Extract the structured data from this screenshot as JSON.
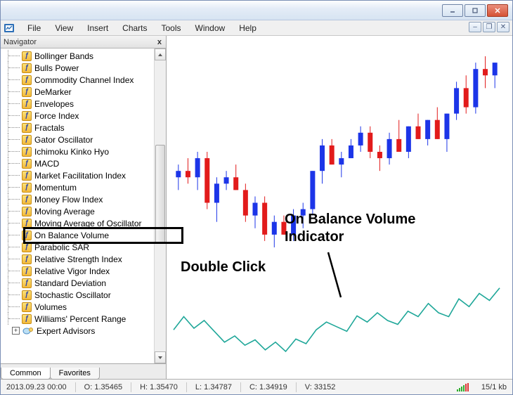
{
  "machine": {
    "window_buttons": {
      "minimize": "–",
      "maximize": "□",
      "close": "✕"
    }
  },
  "menu": {
    "items": [
      "File",
      "View",
      "Insert",
      "Charts",
      "Tools",
      "Window",
      "Help"
    ]
  },
  "inner_window_buttons": {
    "minimize": "–",
    "restore": "❐",
    "close": "✕"
  },
  "navigator": {
    "title": "Navigator",
    "close_glyph": "x",
    "indicators": [
      "Bollinger Bands",
      "Bulls Power",
      "Commodity Channel Index",
      "DeMarker",
      "Envelopes",
      "Force Index",
      "Fractals",
      "Gator Oscillator",
      "Ichimoku Kinko Hyo",
      "MACD",
      "Market Facilitation Index",
      "Momentum",
      "Money Flow Index",
      "Moving Average",
      "Moving Average of Oscillator",
      "On Balance Volume",
      "Parabolic SAR",
      "Relative Strength Index",
      "Relative Vigor Index",
      "Standard Deviation",
      "Stochastic Oscillator",
      "Volumes",
      "Williams' Percent Range"
    ],
    "expert_advisors_label": "Expert Advisors",
    "highlighted_index": 15,
    "tabs": {
      "common": "Common",
      "favorites": "Favorites"
    }
  },
  "annotations": {
    "double_click": "Double Click",
    "obv_title_line1": "On Balance Volume",
    "obv_title_line2": "Indicator"
  },
  "status": {
    "datetime": "2013.09.23 00:00",
    "open_label": "O:",
    "open": "1.35465",
    "high_label": "H:",
    "high": "1.35470",
    "low_label": "L:",
    "low": "1.34787",
    "close_label": "C:",
    "close": "1.34919",
    "vol_label": "V:",
    "vol": "33152",
    "connection": "15/1 kb"
  },
  "colors": {
    "bull": "#1c35e8",
    "bear": "#e21b1b",
    "obv_line": "#1fa799",
    "axis_text": "#000"
  },
  "chart_data": {
    "type": "candlestick",
    "note": "approximate values read from pixels; price axis not visibly labeled",
    "y_range": [
      1.34,
      1.372
    ],
    "obv_y_range": [
      0,
      100
    ],
    "candles": [
      {
        "o": 1.352,
        "h": 1.354,
        "l": 1.35,
        "c": 1.353,
        "dir": "bull"
      },
      {
        "o": 1.353,
        "h": 1.355,
        "l": 1.351,
        "c": 1.352,
        "dir": "bear"
      },
      {
        "o": 1.352,
        "h": 1.356,
        "l": 1.35,
        "c": 1.355,
        "dir": "bull"
      },
      {
        "o": 1.355,
        "h": 1.356,
        "l": 1.347,
        "c": 1.348,
        "dir": "bear"
      },
      {
        "o": 1.348,
        "h": 1.352,
        "l": 1.345,
        "c": 1.351,
        "dir": "bull"
      },
      {
        "o": 1.351,
        "h": 1.353,
        "l": 1.35,
        "c": 1.352,
        "dir": "bull"
      },
      {
        "o": 1.352,
        "h": 1.354,
        "l": 1.35,
        "c": 1.35,
        "dir": "bear"
      },
      {
        "o": 1.35,
        "h": 1.351,
        "l": 1.345,
        "c": 1.346,
        "dir": "bear"
      },
      {
        "o": 1.346,
        "h": 1.349,
        "l": 1.344,
        "c": 1.348,
        "dir": "bull"
      },
      {
        "o": 1.348,
        "h": 1.349,
        "l": 1.342,
        "c": 1.343,
        "dir": "bear"
      },
      {
        "o": 1.343,
        "h": 1.346,
        "l": 1.341,
        "c": 1.345,
        "dir": "bull"
      },
      {
        "o": 1.345,
        "h": 1.346,
        "l": 1.343,
        "c": 1.343,
        "dir": "bear"
      },
      {
        "o": 1.343,
        "h": 1.347,
        "l": 1.342,
        "c": 1.346,
        "dir": "bull"
      },
      {
        "o": 1.346,
        "h": 1.348,
        "l": 1.344,
        "c": 1.347,
        "dir": "bull"
      },
      {
        "o": 1.347,
        "h": 1.353,
        "l": 1.346,
        "c": 1.353,
        "dir": "bull"
      },
      {
        "o": 1.353,
        "h": 1.358,
        "l": 1.351,
        "c": 1.357,
        "dir": "bull"
      },
      {
        "o": 1.357,
        "h": 1.358,
        "l": 1.354,
        "c": 1.354,
        "dir": "bear"
      },
      {
        "o": 1.354,
        "h": 1.356,
        "l": 1.352,
        "c": 1.355,
        "dir": "bull"
      },
      {
        "o": 1.355,
        "h": 1.358,
        "l": 1.355,
        "c": 1.357,
        "dir": "bull"
      },
      {
        "o": 1.357,
        "h": 1.36,
        "l": 1.356,
        "c": 1.359,
        "dir": "bull"
      },
      {
        "o": 1.359,
        "h": 1.36,
        "l": 1.355,
        "c": 1.356,
        "dir": "bear"
      },
      {
        "o": 1.356,
        "h": 1.357,
        "l": 1.353,
        "c": 1.355,
        "dir": "bear"
      },
      {
        "o": 1.355,
        "h": 1.359,
        "l": 1.354,
        "c": 1.358,
        "dir": "bull"
      },
      {
        "o": 1.358,
        "h": 1.361,
        "l": 1.356,
        "c": 1.356,
        "dir": "bear"
      },
      {
        "o": 1.356,
        "h": 1.36,
        "l": 1.355,
        "c": 1.36,
        "dir": "bull"
      },
      {
        "o": 1.36,
        "h": 1.362,
        "l": 1.358,
        "c": 1.358,
        "dir": "bear"
      },
      {
        "o": 1.358,
        "h": 1.361,
        "l": 1.357,
        "c": 1.361,
        "dir": "bull"
      },
      {
        "o": 1.361,
        "h": 1.363,
        "l": 1.358,
        "c": 1.358,
        "dir": "bear"
      },
      {
        "o": 1.358,
        "h": 1.362,
        "l": 1.356,
        "c": 1.362,
        "dir": "bull"
      },
      {
        "o": 1.362,
        "h": 1.367,
        "l": 1.361,
        "c": 1.366,
        "dir": "bull"
      },
      {
        "o": 1.366,
        "h": 1.368,
        "l": 1.362,
        "c": 1.363,
        "dir": "bear"
      },
      {
        "o": 1.363,
        "h": 1.37,
        "l": 1.362,
        "c": 1.369,
        "dir": "bull"
      },
      {
        "o": 1.369,
        "h": 1.371,
        "l": 1.366,
        "c": 1.368,
        "dir": "bear"
      },
      {
        "o": 1.368,
        "h": 1.37,
        "l": 1.366,
        "c": 1.37,
        "dir": "bull"
      }
    ],
    "obv_line": [
      38,
      55,
      40,
      50,
      36,
      22,
      30,
      18,
      25,
      12,
      22,
      10,
      26,
      20,
      38,
      48,
      42,
      36,
      56,
      48,
      60,
      50,
      45,
      62,
      55,
      72,
      60,
      55,
      78,
      68,
      85,
      76,
      92
    ]
  }
}
